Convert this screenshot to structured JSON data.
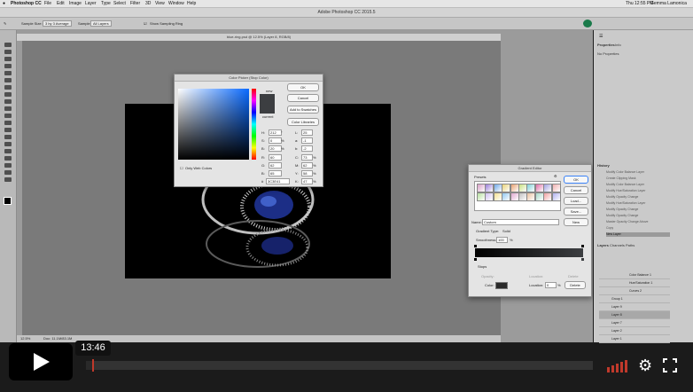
{
  "mac_menubar": {
    "items": [
      "Photoshop CC",
      "File",
      "Edit",
      "Image",
      "Layer",
      "Type",
      "Select",
      "Filter",
      "3D",
      "View",
      "Window",
      "Help"
    ],
    "clock": "Thu 12:55 PM",
    "user": "Gemma Lamonica"
  },
  "ps": {
    "window_title": "Adobe Photoshop CC 2015.5",
    "doc_tab": "blue-ring.psd @ 12.5% (Layer 8, RGB/8)",
    "status_left": "12.5%",
    "status_doc": "Doc: 11.1M/83.1M",
    "options": {
      "sample_size_label": "Sample Size:",
      "sample_size": "3 by 3 Average",
      "sample_label": "Sample:",
      "sample": "All Layers",
      "show_ring": "Show Sampling Ring"
    }
  },
  "color_picker": {
    "title": "Color Picker (Stop Color)",
    "ok": "OK",
    "cancel": "Cancel",
    "add_swatches": "Add to Swatches",
    "color_libraries": "Color Libraries",
    "new_label": "new",
    "current_label": "current",
    "only_web": "Only Web Colors",
    "fields": [
      {
        "label": "H:",
        "value": "212",
        "unit": "°"
      },
      {
        "label": "S:",
        "value": "0",
        "unit": "%"
      },
      {
        "label": "B:",
        "value": "20",
        "unit": "%"
      },
      {
        "label": "R:",
        "value": "60",
        "unit": ""
      },
      {
        "label": "G:",
        "value": "62",
        "unit": ""
      },
      {
        "label": "B:",
        "value": "65",
        "unit": ""
      }
    ],
    "lab": [
      {
        "label": "L:",
        "value": "25"
      },
      {
        "label": "a:",
        "value": "-1"
      },
      {
        "label": "b:",
        "value": "-2"
      }
    ],
    "cmyk": [
      {
        "label": "C:",
        "value": "73",
        "unit": "%"
      },
      {
        "label": "M:",
        "value": "62",
        "unit": "%"
      },
      {
        "label": "Y:",
        "value": "58",
        "unit": "%"
      },
      {
        "label": "K:",
        "value": "47",
        "unit": "%"
      }
    ],
    "hex_label": "#",
    "hex": "3C3E41",
    "current_color": "#3c3e41"
  },
  "gradient_editor": {
    "title": "Gradient Editor",
    "presets_label": "Presets",
    "ok": "OK",
    "cancel": "Cancel",
    "load": "Load...",
    "save": "Save...",
    "name_label": "Name:",
    "name": "Custom",
    "new": "New",
    "type_label": "Gradient Type:",
    "type": "Solid",
    "smooth_label": "Smoothness:",
    "smooth": "100",
    "smooth_unit": "%",
    "stops_label": "Stops",
    "opacity_label": "Opacity:",
    "location_label": "Location:",
    "delete": "Delete",
    "color_label": "Color:",
    "stop_location": "0",
    "stop_location_unit": "%",
    "preset_colors": [
      "#d8a0c8",
      "#9a7dd8",
      "#6ea8e8",
      "#e8d27a",
      "#e8a070",
      "#c8e080",
      "#7fd0d8",
      "#e070a8",
      "#a0a0e0",
      "#f0b0b0",
      "#b8e0a0",
      "#d0c0f0",
      "#f4e090",
      "#90c8f0",
      "#e0a8d0",
      "#c0c0c0",
      "#e8c0a0",
      "#a8d8c8",
      "#f0a0a0",
      "#b0b0f0"
    ]
  },
  "panels": {
    "properties_tab": "Properties",
    "info_tab": "Info",
    "no_properties": "No Properties",
    "history_tab": "History",
    "history": [
      "Modify Color Balance Layer",
      "Create Clipping Mask",
      "Modify Color Balance Layer",
      "Modify Hue/Saturation Layer",
      "Modify Opacity Change",
      "Modify Hue/Saturation Layer",
      "Modify Opacity Change",
      "Modify Opacity Change",
      "Master Opacity Change Above",
      "Copy",
      "New Layer"
    ],
    "layers_tabs": [
      "Layers",
      "Channels",
      "Paths"
    ],
    "layers": [
      "Color Balance 1",
      "Hue/Saturation 1",
      "Curves 2",
      "Group 1",
      "Layer 9",
      "Layer 8",
      "Layer 7",
      "Layer 2",
      "Layer 1"
    ]
  },
  "player": {
    "time": "13:46",
    "progress": 0.012
  }
}
